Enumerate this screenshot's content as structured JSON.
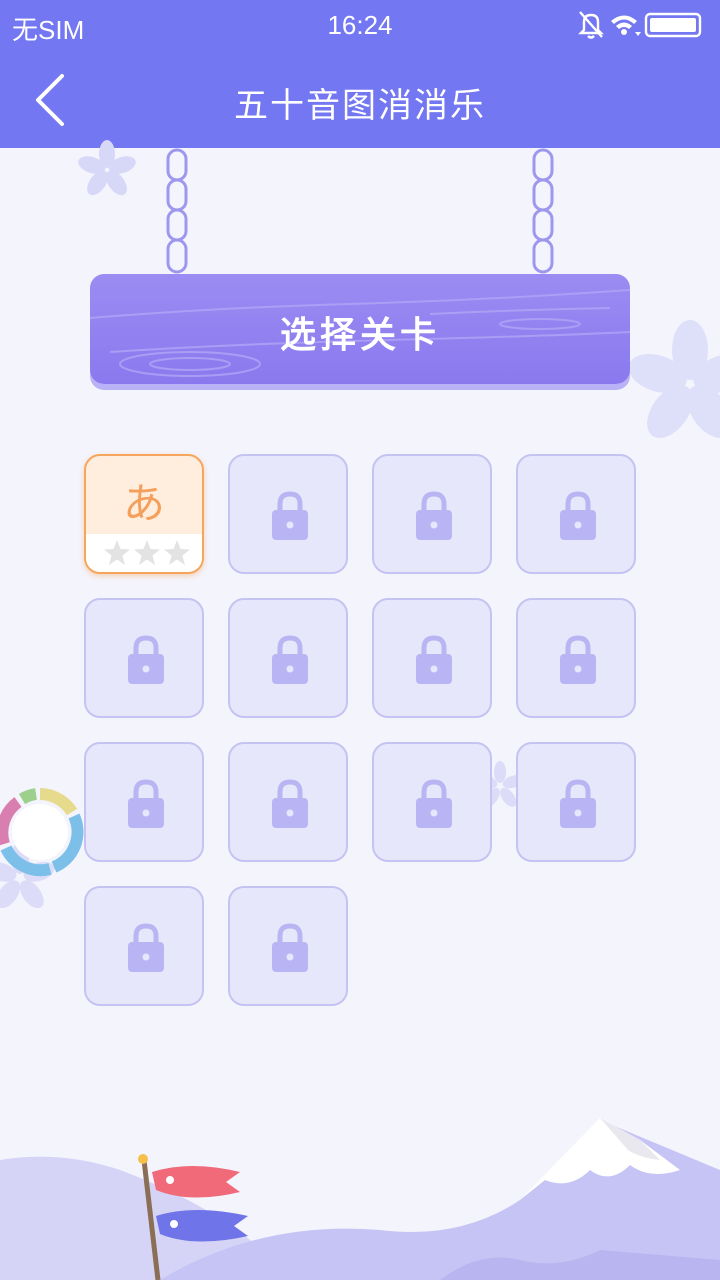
{
  "status_bar": {
    "carrier": "无SIM",
    "time": "16:24",
    "icons": [
      "mute-icon",
      "wifi-icon",
      "battery-icon"
    ]
  },
  "header": {
    "back_icon": "chevron-left-icon",
    "title": "五十音图消消乐"
  },
  "sign": {
    "title": "选择关卡"
  },
  "levels": [
    {
      "state": "unlocked",
      "kana": "あ",
      "stars": 0
    },
    {
      "state": "locked"
    },
    {
      "state": "locked"
    },
    {
      "state": "locked"
    },
    {
      "state": "locked"
    },
    {
      "state": "locked"
    },
    {
      "state": "locked"
    },
    {
      "state": "locked"
    },
    {
      "state": "locked"
    },
    {
      "state": "locked"
    },
    {
      "state": "locked"
    },
    {
      "state": "locked"
    },
    {
      "state": "locked"
    },
    {
      "state": "locked"
    }
  ],
  "colors": {
    "header": "#7377f1",
    "background": "#f4f4fd",
    "sign": "#8a79ee",
    "lock": "#b9b4f3",
    "unlocked_border": "#f6a65c",
    "kana": "#f4a05c"
  }
}
